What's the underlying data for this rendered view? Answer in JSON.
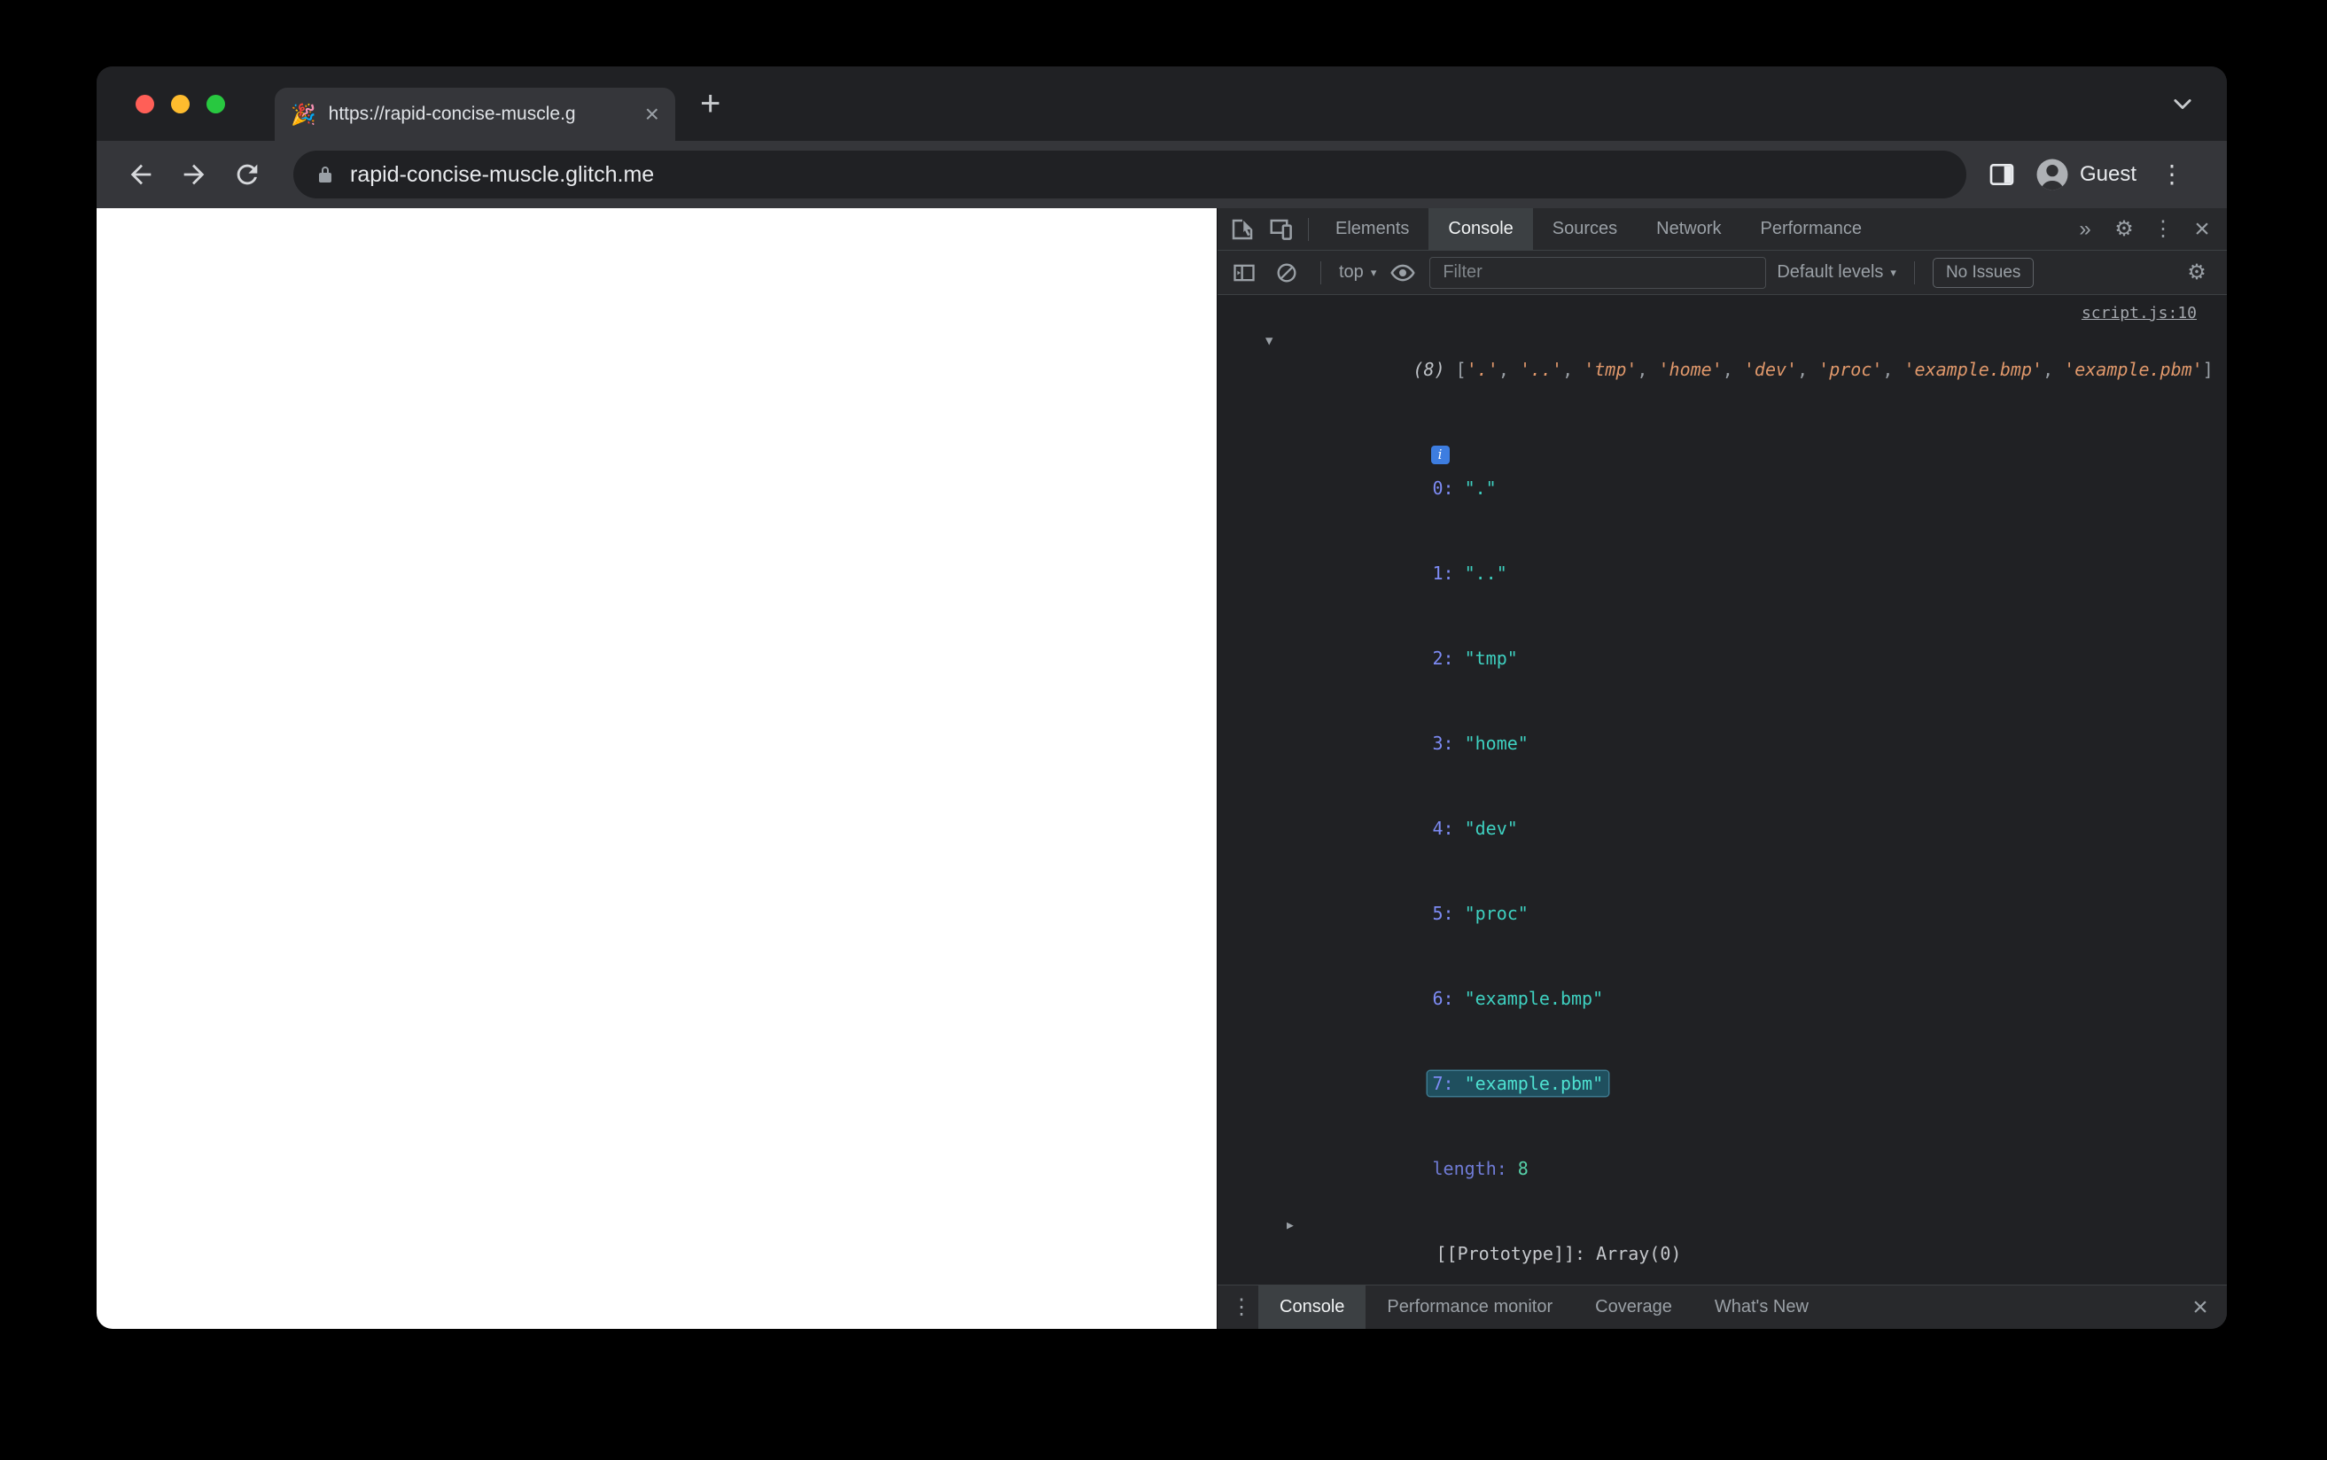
{
  "browser": {
    "tab": {
      "favicon": "🎉",
      "title": "https://rapid-concise-muscle.g"
    },
    "address_bar": {
      "url": "rapid-concise-muscle.glitch.me"
    },
    "profile": {
      "label": "Guest"
    }
  },
  "devtools": {
    "tabs": {
      "items": [
        "Elements",
        "Console",
        "Sources",
        "Network",
        "Performance"
      ],
      "selected": "Console"
    },
    "toolbar": {
      "context": "top",
      "filter_placeholder": "Filter",
      "levels_label": "Default levels",
      "issues_label": "No Issues"
    },
    "console": {
      "source_link": "script.js:10",
      "preview": {
        "count": "(8)",
        "open": "[",
        "close": "]",
        "sep": ", ",
        "items": [
          "'.'",
          "'..'",
          "'tmp'",
          "'home'",
          "'dev'",
          "'proc'",
          "'example.bmp'",
          "'example.pbm'"
        ]
      },
      "entries": [
        {
          "key": "0:",
          "value": "\".\""
        },
        {
          "key": "1:",
          "value": "\"..\""
        },
        {
          "key": "2:",
          "value": "\"tmp\""
        },
        {
          "key": "3:",
          "value": "\"home\""
        },
        {
          "key": "4:",
          "value": "\"dev\""
        },
        {
          "key": "5:",
          "value": "\"proc\""
        },
        {
          "key": "6:",
          "value": "\"example.bmp\""
        },
        {
          "key": "7:",
          "value": "\"example.pbm\""
        }
      ],
      "length_row": {
        "key": "length:",
        "value": "8"
      },
      "prototype_row": {
        "label": "[[Prototype]]:",
        "value": "Array(0)"
      }
    },
    "drawer": {
      "tabs": [
        "Console",
        "Performance monitor",
        "Coverage",
        "What's New"
      ],
      "selected": "Console"
    }
  },
  "icons": {
    "close": "×",
    "new_tab": "+",
    "kebab": "⋮",
    "gear": "⚙",
    "caret_down": "▼",
    "caret_right": "▶",
    "dropdown": "▾",
    "overflow": "»",
    "info": "i"
  },
  "colors": {
    "string_teal": "#3ed0c0",
    "preview_orange": "#e0986b",
    "index_purple": "#7d8bf4",
    "selection_bg": "#1f4f5e",
    "prompt_blue": "#5b7ef7"
  }
}
